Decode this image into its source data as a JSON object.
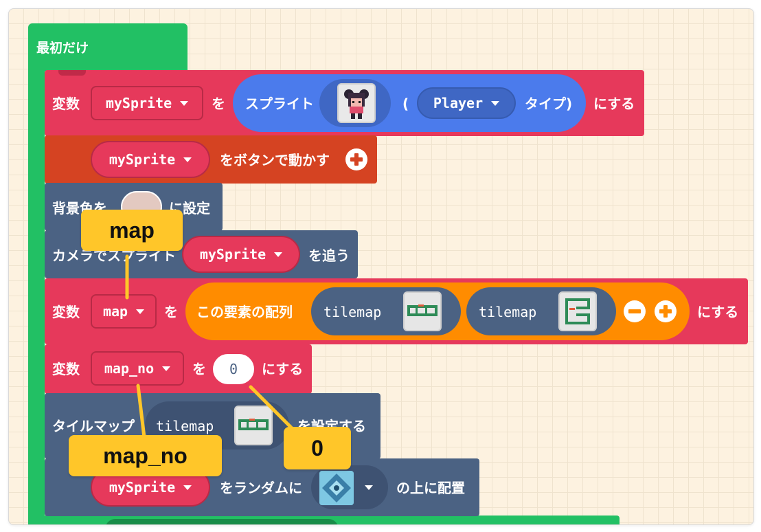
{
  "colors": {
    "workspace_bg": "#fdf2e0",
    "loops_green": "#22c064",
    "variables_red": "#e6395b",
    "controller_orange": "#d54322",
    "scene_slate": "#4b6283",
    "sprites_blue": "#4b7bec",
    "arrays_orange": "#ff8c00",
    "callout_yellow": "#ffc629"
  },
  "on_start": {
    "label": "最初だけ"
  },
  "blocks": {
    "set_sprite": {
      "prefix": "変数",
      "variable": "mySprite",
      "wo": "を",
      "sprite_label": "スプライト",
      "paren_open": "(",
      "kind": "Player",
      "kind_suffix": "タイプ)",
      "suffix": "にする"
    },
    "move_buttons": {
      "variable": "mySprite",
      "label": "をボタンで動かす",
      "add_icon": "plus-circle-icon"
    },
    "background_color": {
      "prefix": "背景色を",
      "suffix": "に設定"
    },
    "camera_follow": {
      "prefix": "カメラでスプライト",
      "variable": "mySprite",
      "suffix": "を追う"
    },
    "set_map": {
      "prefix": "変数",
      "variable": "map",
      "wo": "を",
      "array_label": "この要素の配列",
      "items": [
        "tilemap",
        "tilemap"
      ],
      "remove_icon": "minus-circle-icon",
      "add_icon": "plus-circle-icon",
      "suffix": "にする"
    },
    "set_map_no": {
      "prefix": "変数",
      "variable": "map_no",
      "wo": "を",
      "value": "0",
      "suffix": "にする"
    },
    "set_tilemap": {
      "prefix": "タイルマップ",
      "item": "tilemap",
      "suffix": "を設定する"
    },
    "place_random": {
      "variable": "mySprite",
      "label": "をランダムに",
      "suffix": "の上に配置"
    }
  },
  "callouts": {
    "map": "map",
    "map_no": "map_no",
    "zero": "0"
  }
}
